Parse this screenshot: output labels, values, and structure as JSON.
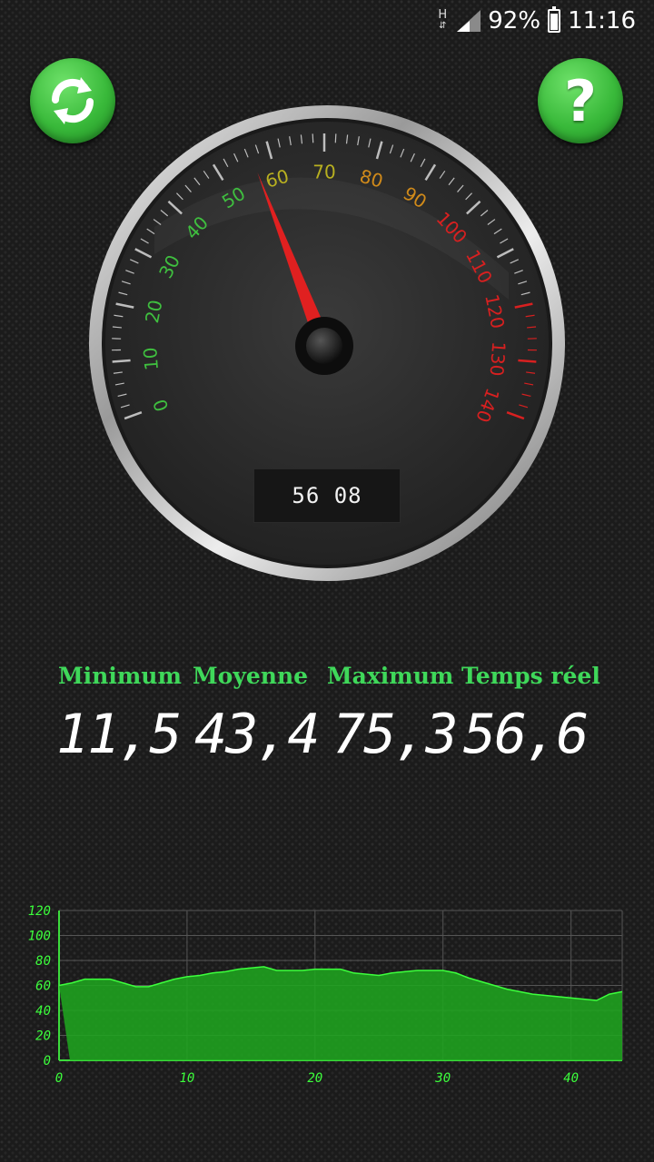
{
  "status_bar": {
    "network": "H",
    "battery": "92%",
    "battery_level": 0.92,
    "time": "11:16"
  },
  "buttons": {
    "refresh_icon": "refresh-arrows-icon",
    "help_label": "?"
  },
  "gauge": {
    "min": 0,
    "max": 140,
    "value": 56.6,
    "tick_labels": [
      "0",
      "10",
      "20",
      "30",
      "40",
      "50",
      "60",
      "70",
      "80",
      "90",
      "100",
      "110",
      "120",
      "130",
      "140"
    ],
    "readout": "56 08",
    "colors": {
      "green": "#3fbf3f",
      "yellow": "#b8b020",
      "orange": "#d08a1a",
      "red": "#d82020",
      "needle": "#e02020"
    }
  },
  "stats": {
    "minimum": {
      "label": "Minimum",
      "value": "11,5"
    },
    "moyenne": {
      "label": "Moyenne",
      "value": "43,4"
    },
    "maximum": {
      "label": "Maximum",
      "value": "75,3"
    },
    "temps_reel": {
      "label": "Temps réel",
      "value": "56,6"
    }
  },
  "chart_data": {
    "type": "area",
    "x_ticks": [
      "0",
      "10",
      "20",
      "30",
      "40"
    ],
    "y_ticks": [
      "0",
      "20",
      "40",
      "60",
      "80",
      "100",
      "120"
    ],
    "xlim": [
      0,
      44
    ],
    "ylim": [
      0,
      120
    ],
    "grid": true,
    "color": "#1fa81f",
    "line_color": "#3cff3c",
    "x": [
      0,
      1,
      2,
      3,
      4,
      5,
      6,
      7,
      8,
      9,
      10,
      11,
      12,
      13,
      14,
      15,
      16,
      17,
      18,
      19,
      20,
      21,
      22,
      23,
      24,
      25,
      26,
      27,
      28,
      29,
      30,
      31,
      32,
      33,
      34,
      35,
      36,
      37,
      38,
      39,
      40,
      41,
      42,
      43,
      44
    ],
    "y": [
      60,
      62,
      65,
      65,
      65,
      62,
      59,
      59,
      62,
      65,
      67,
      68,
      70,
      71,
      73,
      74,
      75,
      72,
      72,
      72,
      73,
      73,
      73,
      70,
      69,
      68,
      70,
      71,
      72,
      72,
      72,
      70,
      66,
      63,
      60,
      57,
      55,
      53,
      52,
      51,
      50,
      49,
      48,
      53,
      55
    ]
  }
}
